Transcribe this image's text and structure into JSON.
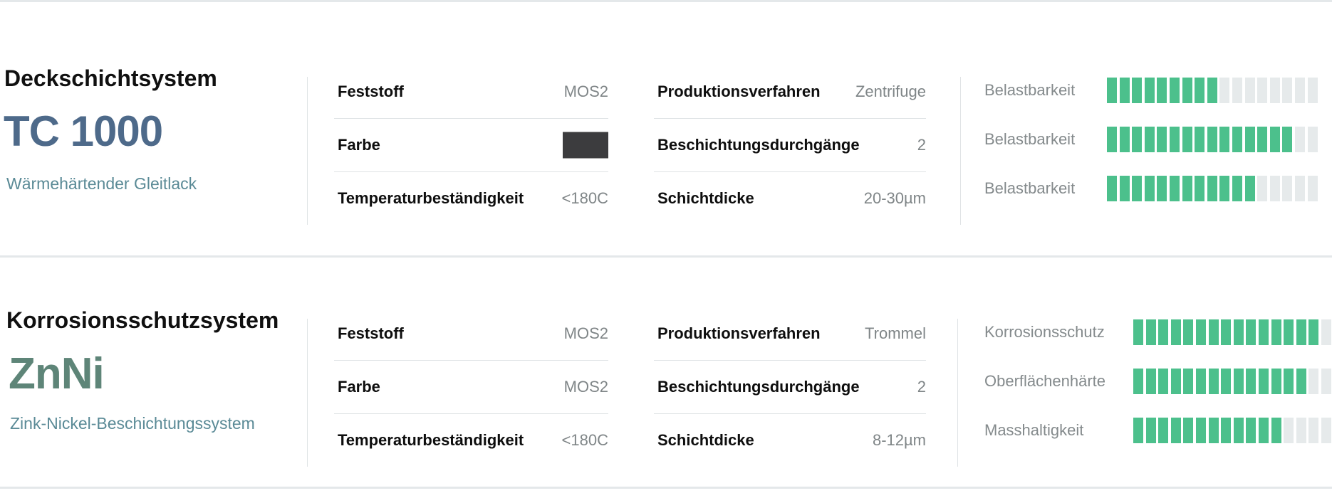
{
  "products": [
    {
      "system_label": "Deckschichtsystem",
      "name": "TC 1000",
      "description": "Wärmehärtender Gleitlack",
      "specs_left": [
        {
          "key": "Feststoff",
          "value": "MOS2"
        },
        {
          "key": "Farbe",
          "value": "",
          "swatch": "#3c3c3e"
        },
        {
          "key": "Temperaturbeständigkeit",
          "value": "<180C"
        }
      ],
      "specs_right": [
        {
          "key": "Produktionsverfahren",
          "value": "Zentrifuge"
        },
        {
          "key": "Beschichtungsdurchgänge",
          "value": "2"
        },
        {
          "key": "Schichtdicke",
          "value": "20-30µm"
        }
      ],
      "ratings": [
        {
          "label": "Belastbarkeit",
          "filled": 9,
          "total": 17
        },
        {
          "label": "Belastbarkeit",
          "filled": 15,
          "total": 17
        },
        {
          "label": "Belastbarkeit",
          "filled": 12,
          "total": 17
        }
      ]
    },
    {
      "system_label": "Korrosionsschutzsystem",
      "name": "ZnNi",
      "description": "Zink-Nickel-Beschichtungssystem",
      "specs_left": [
        {
          "key": "Feststoff",
          "value": "MOS2"
        },
        {
          "key": "Farbe",
          "value": "MOS2"
        },
        {
          "key": "Temperaturbeständigkeit",
          "value": "<180C"
        }
      ],
      "specs_right": [
        {
          "key": "Produktionsverfahren",
          "value": "Trommel"
        },
        {
          "key": "Beschichtungsdurchgänge",
          "value": "2"
        },
        {
          "key": "Schichtdicke",
          "value": "8-12µm"
        }
      ],
      "ratings": [
        {
          "label": "Korrosionsschutz",
          "filled": 15,
          "total": 16
        },
        {
          "label": "Oberflächenhärte",
          "filled": 14,
          "total": 16
        },
        {
          "label": "Masshaltigkeit",
          "filled": 12,
          "total": 16
        }
      ]
    }
  ],
  "colors": {
    "accent_green": "#4cc08c",
    "segment_empty": "#e6eaeb",
    "product_name_1": "#4e6a8a",
    "product_name_2": "#5e8578",
    "description": "#5a8a96"
  }
}
